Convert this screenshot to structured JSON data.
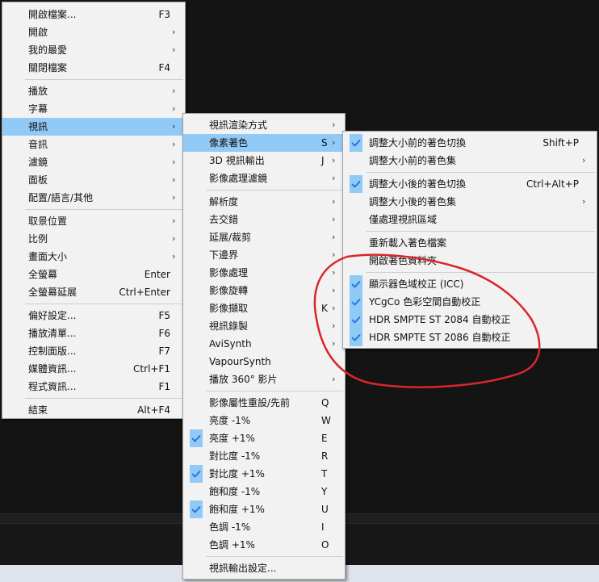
{
  "main_menu": {
    "items": [
      {
        "label": "開啟檔案...",
        "shortcut": "F3"
      },
      {
        "label": "開啟",
        "submenu": true
      },
      {
        "label": "我的最愛",
        "submenu": true
      },
      {
        "label": "關閉檔案",
        "shortcut": "F4"
      },
      {
        "separator": true
      },
      {
        "label": "播放",
        "submenu": true
      },
      {
        "label": "字幕",
        "submenu": true
      },
      {
        "label": "視訊",
        "submenu": true,
        "highlighted": true
      },
      {
        "label": "音訊",
        "submenu": true
      },
      {
        "label": "濾鏡",
        "submenu": true
      },
      {
        "label": "面板",
        "submenu": true
      },
      {
        "label": "配置/語言/其他",
        "submenu": true
      },
      {
        "separator": true
      },
      {
        "label": "取景位置",
        "submenu": true
      },
      {
        "label": "比例",
        "submenu": true
      },
      {
        "label": "畫面大小",
        "submenu": true
      },
      {
        "label": "全螢幕",
        "shortcut": "Enter"
      },
      {
        "label": "全螢幕延展",
        "shortcut": "Ctrl+Enter"
      },
      {
        "separator": true
      },
      {
        "label": "偏好設定...",
        "shortcut": "F5"
      },
      {
        "label": "播放清單...",
        "shortcut": "F6"
      },
      {
        "label": "控制面版...",
        "shortcut": "F7"
      },
      {
        "label": "媒體資訊...",
        "shortcut": "Ctrl+F1"
      },
      {
        "label": "程式資訊...",
        "shortcut": "F1"
      },
      {
        "separator": true
      },
      {
        "label": "結束",
        "shortcut": "Alt+F4"
      }
    ]
  },
  "video_menu": {
    "items": [
      {
        "label": "視訊渲染方式",
        "submenu": true
      },
      {
        "label": "像素著色",
        "shortcut": "S",
        "submenu": true,
        "highlighted": true
      },
      {
        "label": "3D 視訊輸出",
        "shortcut": "J",
        "submenu": true
      },
      {
        "label": "影像處理濾鏡",
        "submenu": true
      },
      {
        "separator": true
      },
      {
        "label": "解析度",
        "submenu": true
      },
      {
        "label": "去交錯",
        "submenu": true
      },
      {
        "label": "延展/裁剪",
        "submenu": true
      },
      {
        "label": "下邊界",
        "submenu": true
      },
      {
        "label": "影像處理",
        "submenu": true
      },
      {
        "label": "影像旋轉",
        "submenu": true
      },
      {
        "label": "影像擷取",
        "shortcut": "K",
        "submenu": true
      },
      {
        "label": "視訊錄製",
        "submenu": true
      },
      {
        "label": "AviSynth",
        "submenu": true
      },
      {
        "label": "VapourSynth"
      },
      {
        "label": "播放 360° 影片",
        "submenu": true
      },
      {
        "separator": true
      },
      {
        "label": "影像屬性重設/先前",
        "shortcut": "Q"
      },
      {
        "label": "亮度 -1%",
        "shortcut": "W"
      },
      {
        "label": "亮度 +1%",
        "shortcut": "E",
        "checked": true
      },
      {
        "label": "對比度 -1%",
        "shortcut": "R"
      },
      {
        "label": "對比度 +1%",
        "shortcut": "T",
        "checked": true
      },
      {
        "label": "飽和度 -1%",
        "shortcut": "Y"
      },
      {
        "label": "飽和度 +1%",
        "shortcut": "U",
        "checked": true
      },
      {
        "label": "色調 -1%",
        "shortcut": "I"
      },
      {
        "label": "色調 +1%",
        "shortcut": "O"
      },
      {
        "separator": true
      },
      {
        "label": "視訊輸出設定..."
      }
    ]
  },
  "shader_menu": {
    "items": [
      {
        "label": "調整大小前的著色切換",
        "shortcut": "Shift+P",
        "checked": true
      },
      {
        "label": "調整大小前的著色集",
        "submenu": true
      },
      {
        "separator": true
      },
      {
        "label": "調整大小後的著色切換",
        "shortcut": "Ctrl+Alt+P",
        "checked": true
      },
      {
        "label": "調整大小後的著色集",
        "submenu": true
      },
      {
        "label": "僅處理視訊區域"
      },
      {
        "separator": true
      },
      {
        "label": "重新載入著色檔案"
      },
      {
        "label": "開啟著色資料夾"
      },
      {
        "separator": true
      },
      {
        "label": "顯示器色域校正 (ICC)",
        "checked": true
      },
      {
        "label": "YCgCo 色彩空間自動校正",
        "checked": true
      },
      {
        "label": "HDR SMPTE ST 2084 自動校正",
        "checked": true
      },
      {
        "label": "HDR SMPTE ST 2086 自動校正",
        "checked": true
      }
    ]
  },
  "colors": {
    "highlight": "#91c9f7",
    "menu_bg": "#f2f2f2",
    "annotation": "#d9262c",
    "check": "#1a73d9"
  }
}
